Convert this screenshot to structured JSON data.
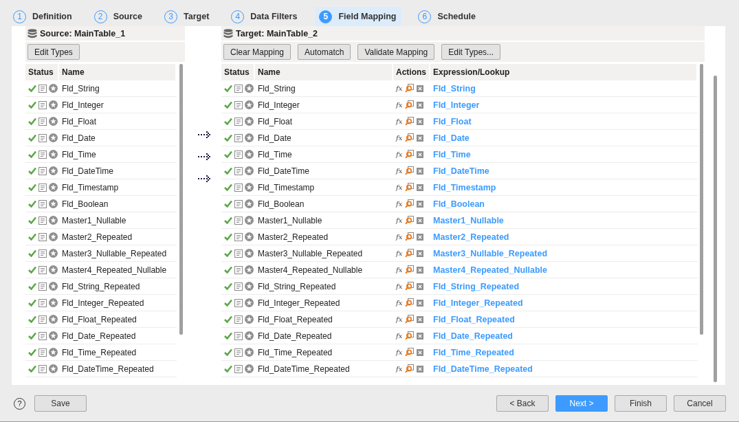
{
  "steps": [
    {
      "number": "1",
      "label": "Definition",
      "selected": false
    },
    {
      "number": "2",
      "label": "Source",
      "selected": false
    },
    {
      "number": "3",
      "label": "Target",
      "selected": false
    },
    {
      "number": "4",
      "label": "Data Filters",
      "selected": false
    },
    {
      "number": "5",
      "label": "Field Mapping",
      "selected": true
    },
    {
      "number": "6",
      "label": "Schedule",
      "selected": false
    }
  ],
  "source": {
    "title": "Source: MainTable_1",
    "buttons": [
      "Edit Types"
    ],
    "columns": [
      "Status",
      "Name"
    ],
    "rows": [
      {
        "name": "Fld_String"
      },
      {
        "name": "Fld_Integer"
      },
      {
        "name": "Fld_Float"
      },
      {
        "name": "Fld_Date"
      },
      {
        "name": "Fld_Time"
      },
      {
        "name": "Fld_DateTime"
      },
      {
        "name": "Fld_Timestamp"
      },
      {
        "name": "Fld_Boolean"
      },
      {
        "name": "Master1_Nullable"
      },
      {
        "name": "Master2_Repeated"
      },
      {
        "name": "Master3_Nullable_Repeated"
      },
      {
        "name": "Master4_Repeated_Nullable"
      },
      {
        "name": "Fld_String_Repeated"
      },
      {
        "name": "Fld_Integer_Repeated"
      },
      {
        "name": "Fld_Float_Repeated"
      },
      {
        "name": "Fld_Date_Repeated"
      },
      {
        "name": "Fld_Time_Repeated"
      },
      {
        "name": "Fld_DateTime_Repeated"
      }
    ]
  },
  "target": {
    "title": "Target: MainTable_2",
    "buttons": [
      "Clear Mapping",
      "Automatch",
      "Validate Mapping",
      "Edit Types..."
    ],
    "columns": [
      "Status",
      "Name",
      "Actions",
      "Expression/Lookup"
    ],
    "rows": [
      {
        "name": "Fld_String",
        "function": "fx",
        "expression": "Fld_String"
      },
      {
        "name": "Fld_Integer",
        "function": "fx",
        "expression": "Fld_Integer"
      },
      {
        "name": "Fld_Float",
        "function": "fx",
        "expression": "Fld_Float"
      },
      {
        "name": "Fld_Date",
        "function": "fx",
        "expression": "Fld_Date"
      },
      {
        "name": "Fld_Time",
        "function": "fx",
        "expression": "Fld_Time"
      },
      {
        "name": "Fld_DateTime",
        "function": "fx",
        "expression": "Fld_DateTime"
      },
      {
        "name": "Fld_Timestamp",
        "function": "fx",
        "expression": "Fld_Timestamp"
      },
      {
        "name": "Fld_Boolean",
        "function": "fx",
        "expression": "Fld_Boolean"
      },
      {
        "name": "Master1_Nullable",
        "function": "fx",
        "expression": "Master1_Nullable"
      },
      {
        "name": "Master2_Repeated",
        "function": "fx",
        "expression": "Master2_Repeated"
      },
      {
        "name": "Master3_Nullable_Repeated",
        "function": "fx",
        "expression": "Master3_Nullable_Repeated"
      },
      {
        "name": "Master4_Repeated_Nullable",
        "function": "fx",
        "expression": "Master4_Repeated_Nullable"
      },
      {
        "name": "Fld_String_Repeated",
        "function": "fx",
        "expression": "Fld_String_Repeated"
      },
      {
        "name": "Fld_Integer_Repeated",
        "function": "fx",
        "expression": "Fld_Integer_Repeated"
      },
      {
        "name": "Fld_Float_Repeated",
        "function": "fx",
        "expression": "Fld_Float_Repeated"
      },
      {
        "name": "Fld_Date_Repeated",
        "function": "fx",
        "expression": "Fld_Date_Repeated"
      },
      {
        "name": "Fld_Time_Repeated",
        "function": "fx",
        "expression": "Fld_Time_Repeated"
      },
      {
        "name": "Fld_DateTime_Repeated",
        "function": "fx",
        "expression": "Fld_DateTime_Repeated"
      }
    ]
  },
  "footer": {
    "help": "?",
    "left_buttons": [
      {
        "label": "Save",
        "primary": false
      }
    ],
    "right_buttons": [
      {
        "label": "< Back",
        "primary": false
      },
      {
        "label": "Next >",
        "primary": true
      },
      {
        "label": "Finish",
        "primary": false
      },
      {
        "label": "Cancel",
        "primary": false
      }
    ]
  }
}
